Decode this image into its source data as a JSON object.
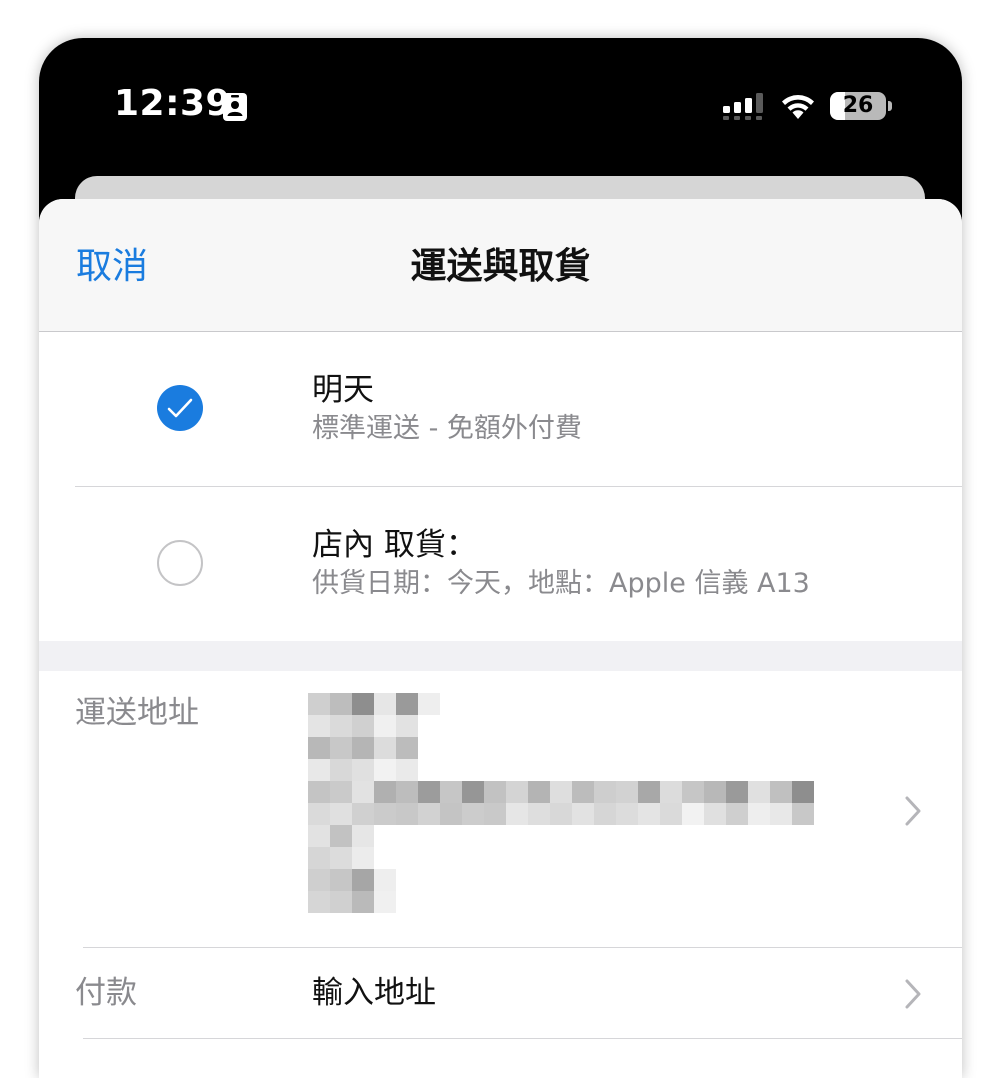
{
  "status_bar": {
    "time": "12:39",
    "battery_level": "26",
    "battery_fraction": 0.26
  },
  "nav": {
    "cancel_label": "取消",
    "title": "運送與取貨"
  },
  "delivery_options": [
    {
      "title": "明天",
      "subtitle": "標準運送 - 免額外付費",
      "selected": true
    },
    {
      "title": "店內 取貨：",
      "subtitle": "供貨日期：今天，地點：Apple 信義 A13",
      "selected": false
    }
  ],
  "shipping_address": {
    "label": "運送地址"
  },
  "payment": {
    "label": "付款",
    "value": "輸入地址"
  },
  "colors": {
    "accent": "#1a7cdf",
    "secondary_text": "#8a8a8e"
  },
  "icons": [
    "contact-card-icon",
    "cellular-signal-icon",
    "wifi-icon",
    "battery-icon",
    "checkmark-icon",
    "chevron-right-icon"
  ]
}
